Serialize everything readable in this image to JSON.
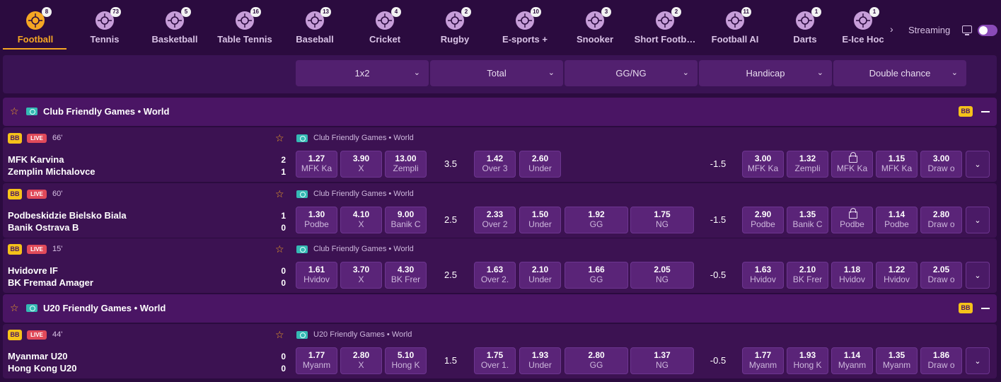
{
  "nav": {
    "sports": [
      {
        "label": "Football",
        "count": "8",
        "icon": "football-icon",
        "active": true
      },
      {
        "label": "Tennis",
        "count": "73",
        "icon": "tennis-icon"
      },
      {
        "label": "Basketball",
        "count": "5",
        "icon": "basketball-icon"
      },
      {
        "label": "Table Tennis",
        "count": "16",
        "icon": "table-tennis-icon"
      },
      {
        "label": "Baseball",
        "count": "13",
        "icon": "baseball-icon"
      },
      {
        "label": "Cricket",
        "count": "4",
        "icon": "cricket-icon"
      },
      {
        "label": "Rugby",
        "count": "2",
        "icon": "rugby-icon"
      },
      {
        "label": "E-sports +",
        "count": "10",
        "icon": "gamepad-icon"
      },
      {
        "label": "Snooker",
        "count": "3",
        "icon": "snooker-icon"
      },
      {
        "label": "Short Footb…",
        "count": "2",
        "icon": "short-football-icon"
      },
      {
        "label": "Football AI",
        "count": "11",
        "icon": "football-ai-icon"
      },
      {
        "label": "Darts",
        "count": "1",
        "icon": "darts-icon"
      },
      {
        "label": "E-Ice Hoc",
        "count": "1",
        "icon": "e-ice-hockey-icon"
      }
    ],
    "streaming_label": "Streaming",
    "streaming_on": true
  },
  "markets": [
    "1x2",
    "Total",
    "GG/NG",
    "Handicap",
    "Double chance"
  ],
  "groups": [
    {
      "league": "Club Friendly Games • World",
      "badge": "BB",
      "matches": [
        {
          "badge": "BB",
          "live": "LIVE",
          "minute": "66'",
          "league": "Club Friendly Games • World",
          "home": "MFK Karvina",
          "away": "Zemplin Michalovce",
          "home_score": "2",
          "away_score": "1",
          "x12": [
            {
              "odd": "1.27",
              "label": "MFK Ka"
            },
            {
              "odd": "3.90",
              "label": "X"
            },
            {
              "odd": "13.00",
              "label": "Zempli"
            }
          ],
          "total_line": "3.5",
          "total": [
            {
              "odd": "1.42",
              "label": "Over 3"
            },
            {
              "odd": "2.60",
              "label": "Under"
            }
          ],
          "ggng": [],
          "handicap_line": "-1.5",
          "handicap": [
            {
              "odd": "3.00",
              "label": "MFK Ka"
            },
            {
              "odd": "1.32",
              "label": "Zempli"
            }
          ],
          "double": [
            {
              "odd": "",
              "label": "MFK Ka",
              "locked": true
            },
            {
              "odd": "1.15",
              "label": "MFK Ka"
            },
            {
              "odd": "3.00",
              "label": "Draw o"
            }
          ]
        },
        {
          "badge": "BB",
          "live": "LIVE",
          "minute": "60'",
          "league": "Club Friendly Games • World",
          "home": "Podbeskidzie Bielsko Biala",
          "away": "Banik Ostrava B",
          "home_score": "1",
          "away_score": "0",
          "x12": [
            {
              "odd": "1.30",
              "label": "Podbe"
            },
            {
              "odd": "4.10",
              "label": "X"
            },
            {
              "odd": "9.00",
              "label": "Banik C"
            }
          ],
          "total_line": "2.5",
          "total": [
            {
              "odd": "2.33",
              "label": "Over 2"
            },
            {
              "odd": "1.50",
              "label": "Under"
            }
          ],
          "ggng": [
            {
              "odd": "1.92",
              "label": "GG"
            },
            {
              "odd": "1.75",
              "label": "NG"
            }
          ],
          "handicap_line": "-1.5",
          "handicap": [
            {
              "odd": "2.90",
              "label": "Podbe"
            },
            {
              "odd": "1.35",
              "label": "Banik C"
            }
          ],
          "double": [
            {
              "odd": "",
              "label": "Podbe",
              "locked": true
            },
            {
              "odd": "1.14",
              "label": "Podbe"
            },
            {
              "odd": "2.80",
              "label": "Draw o"
            }
          ]
        },
        {
          "badge": "BB",
          "live": "LIVE",
          "minute": "15'",
          "league": "Club Friendly Games • World",
          "home": "Hvidovre IF",
          "away": "BK Fremad Amager",
          "home_score": "0",
          "away_score": "0",
          "x12": [
            {
              "odd": "1.61",
              "label": "Hvidov"
            },
            {
              "odd": "3.70",
              "label": "X"
            },
            {
              "odd": "4.30",
              "label": "BK Frer"
            }
          ],
          "total_line": "2.5",
          "total": [
            {
              "odd": "1.63",
              "label": "Over 2."
            },
            {
              "odd": "2.10",
              "label": "Under"
            }
          ],
          "ggng": [
            {
              "odd": "1.66",
              "label": "GG"
            },
            {
              "odd": "2.05",
              "label": "NG"
            }
          ],
          "handicap_line": "-0.5",
          "handicap": [
            {
              "odd": "1.63",
              "label": "Hvidov"
            },
            {
              "odd": "2.10",
              "label": "BK Frer"
            }
          ],
          "double": [
            {
              "odd": "1.18",
              "label": "Hvidov"
            },
            {
              "odd": "1.22",
              "label": "Hvidov"
            },
            {
              "odd": "2.05",
              "label": "Draw o"
            }
          ]
        }
      ]
    },
    {
      "league": "U20 Friendly Games • World",
      "badge": "BB",
      "matches": [
        {
          "badge": "BB",
          "live": "LIVE",
          "minute": "44'",
          "league": "U20 Friendly Games • World",
          "home": "Myanmar U20",
          "away": "Hong Kong U20",
          "home_score": "0",
          "away_score": "0",
          "x12": [
            {
              "odd": "1.77",
              "label": "Myanm"
            },
            {
              "odd": "2.80",
              "label": "X"
            },
            {
              "odd": "5.10",
              "label": "Hong K"
            }
          ],
          "total_line": "1.5",
          "total": [
            {
              "odd": "1.75",
              "label": "Over 1."
            },
            {
              "odd": "1.93",
              "label": "Under"
            }
          ],
          "ggng": [
            {
              "odd": "2.80",
              "label": "GG"
            },
            {
              "odd": "1.37",
              "label": "NG"
            }
          ],
          "handicap_line": "-0.5",
          "handicap": [
            {
              "odd": "1.77",
              "label": "Myanm"
            },
            {
              "odd": "1.93",
              "label": "Hong K"
            }
          ],
          "double": [
            {
              "odd": "1.14",
              "label": "Myanm"
            },
            {
              "odd": "1.35",
              "label": "Myanm"
            },
            {
              "odd": "1.86",
              "label": "Draw o"
            }
          ]
        }
      ]
    }
  ]
}
